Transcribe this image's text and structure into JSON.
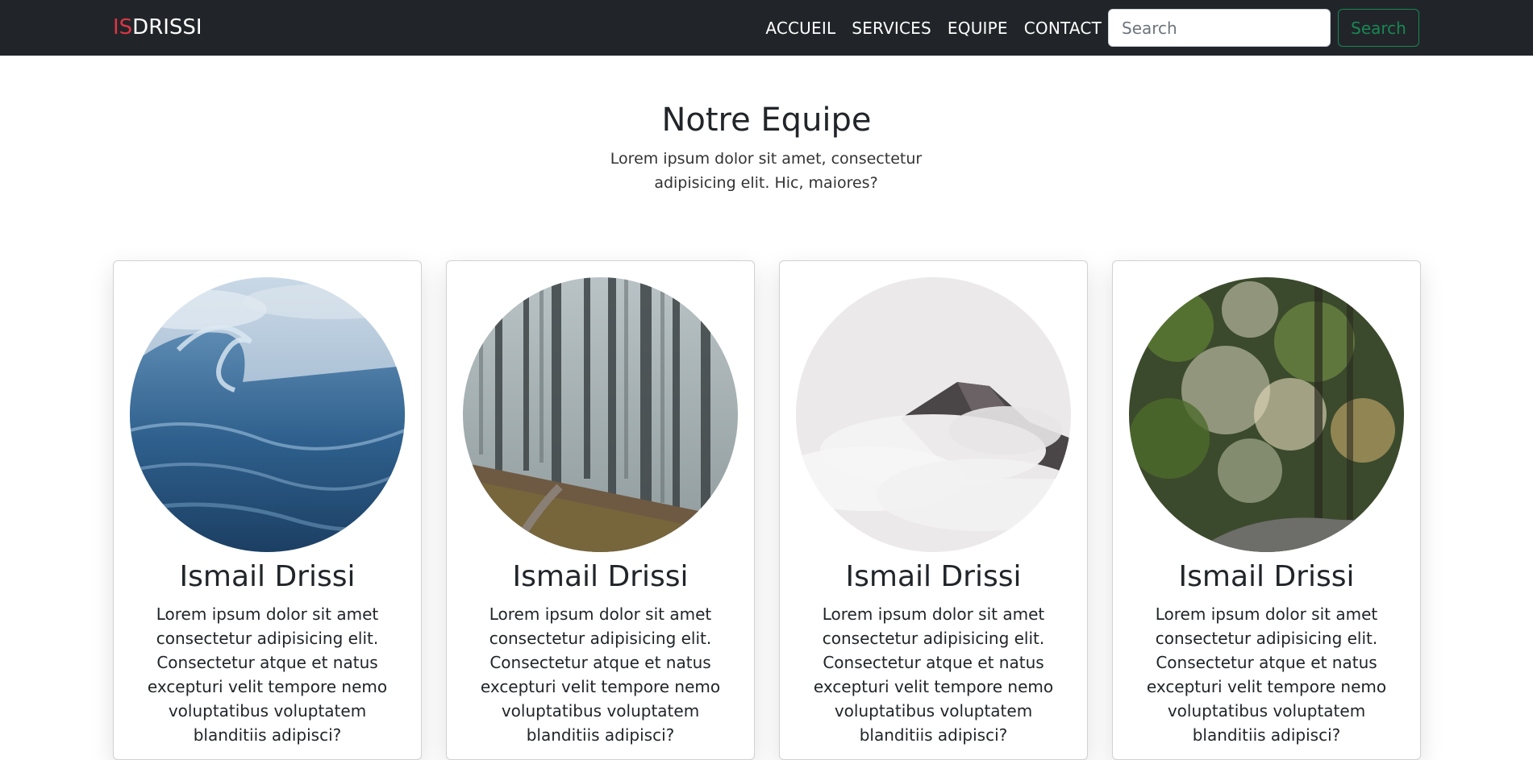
{
  "navbar": {
    "brand_accent": "IS",
    "brand_rest": "DRISSI",
    "links": [
      "ACCUEIL",
      "SERVICES",
      "EQUIPE",
      "CONTACT"
    ],
    "search_placeholder": "Search",
    "search_button": "Search"
  },
  "section": {
    "title": "Notre Equipe",
    "subtitle": "Lorem ipsum dolor sit amet, consectetur adipisicing elit. Hic, maiores?"
  },
  "cards": [
    {
      "image": "ocean-wave-photo",
      "name": "Ismail Drissi",
      "text": "Lorem ipsum dolor sit amet consectetur adipisicing elit. Consectetur atque et natus excepturi velit tempore nemo voluptatibus voluptatem blanditiis adipisci?"
    },
    {
      "image": "misty-forest-photo",
      "name": "Ismail Drissi",
      "text": "Lorem ipsum dolor sit amet consectetur adipisicing elit. Consectetur atque et natus excepturi velit tempore nemo voluptatibus voluptatem blanditiis adipisci?"
    },
    {
      "image": "foggy-mountain-photo",
      "name": "Ismail Drissi",
      "text": "Lorem ipsum dolor sit amet consectetur adipisicing elit. Consectetur atque et natus excepturi velit tempore nemo voluptatibus voluptatem blanditiis adipisci?"
    },
    {
      "image": "green-foliage-photo",
      "name": "Ismail Drissi",
      "text": "Lorem ipsum dolor sit amet consectetur adipisicing elit. Consectetur atque et natus excepturi velit tempore nemo voluptatibus voluptatem blanditiis adipisci?"
    }
  ],
  "colors": {
    "navbar_bg": "#212529",
    "brand_accent": "#dc3545",
    "search_button": "#198754",
    "text": "#212529"
  }
}
